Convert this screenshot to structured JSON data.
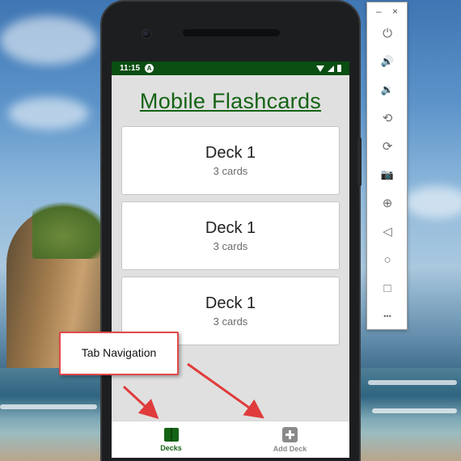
{
  "status_bar": {
    "time": "11:15",
    "notification_glyph": "A"
  },
  "app": {
    "title": "Mobile Flashcards"
  },
  "decks": [
    {
      "name": "Deck 1",
      "count": "3 cards"
    },
    {
      "name": "Deck 1",
      "count": "3 cards"
    },
    {
      "name": "Deck 1",
      "count": "3 cards"
    }
  ],
  "tabs": [
    {
      "label": "Decks",
      "icon": "book-icon",
      "active": true
    },
    {
      "label": "Add Deck",
      "icon": "plus-box-icon",
      "active": false
    }
  ],
  "emulator_toolbar": {
    "minimize_glyph": "–",
    "close_glyph": "×",
    "buttons": [
      {
        "name": "power",
        "icon": "power-icon",
        "glyph": "⏻"
      },
      {
        "name": "volume-up",
        "icon": "volume-up-icon",
        "glyph": "🔊"
      },
      {
        "name": "volume-down",
        "icon": "volume-down-icon",
        "glyph": "🔉"
      },
      {
        "name": "rotate-left",
        "icon": "rotate-left-icon",
        "glyph": "⟲"
      },
      {
        "name": "rotate-right",
        "icon": "rotate-right-icon",
        "glyph": "⟳"
      },
      {
        "name": "screenshot",
        "icon": "camera-icon",
        "glyph": "📷"
      },
      {
        "name": "zoom",
        "icon": "zoom-icon",
        "glyph": "⊕"
      },
      {
        "name": "back",
        "icon": "back-icon",
        "glyph": "◁"
      },
      {
        "name": "home",
        "icon": "home-icon",
        "glyph": "○"
      },
      {
        "name": "overview",
        "icon": "overview-icon",
        "glyph": "□"
      },
      {
        "name": "more",
        "icon": "more-icon",
        "glyph": "•••"
      }
    ]
  },
  "callout": {
    "text": "Tab Navigation"
  },
  "colors": {
    "accent": "#146314",
    "status_bar": "#0a4e12",
    "callout_border": "#e04a4a",
    "arrow": "#e03c3c"
  }
}
